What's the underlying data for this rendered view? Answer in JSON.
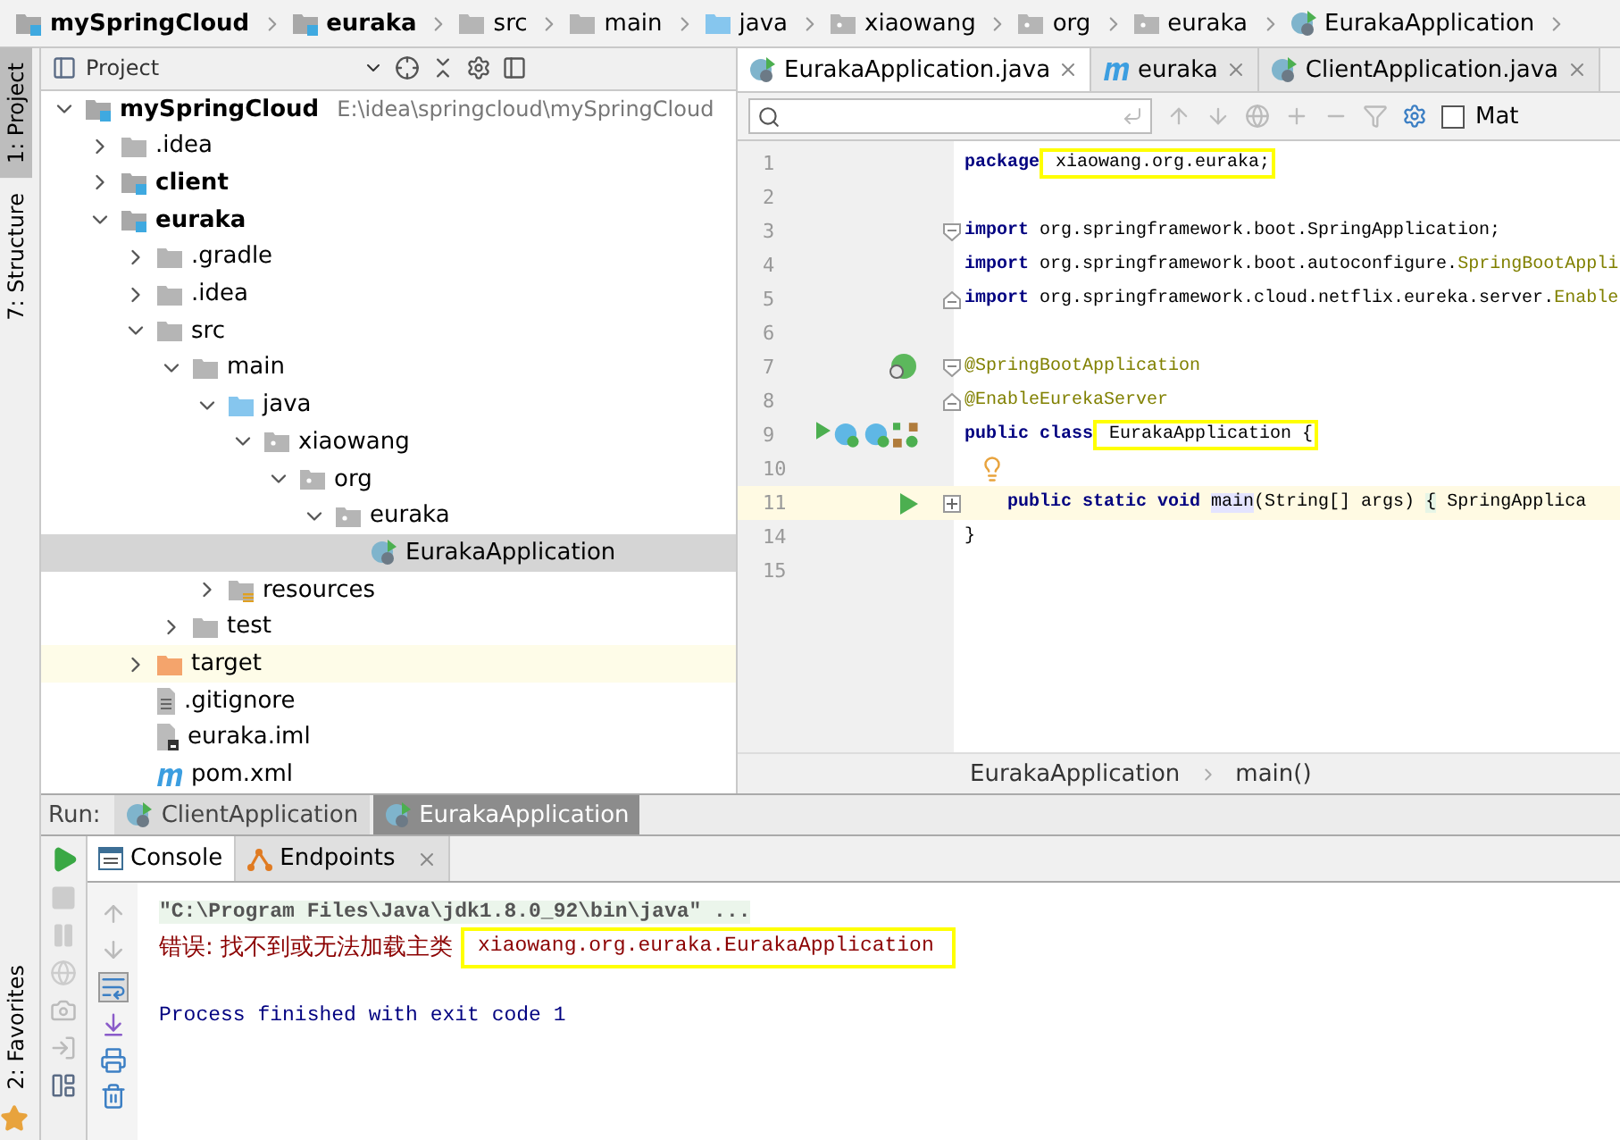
{
  "breadcrumbs": [
    {
      "label": "mySpringCloud",
      "kind": "module",
      "bold": true
    },
    {
      "label": "euraka",
      "kind": "module",
      "bold": true
    },
    {
      "label": "src",
      "kind": "folder",
      "bold": false
    },
    {
      "label": "main",
      "kind": "folder",
      "bold": false
    },
    {
      "label": "java",
      "kind": "source",
      "bold": false
    },
    {
      "label": "xiaowang",
      "kind": "package",
      "bold": false
    },
    {
      "label": "org",
      "kind": "package",
      "bold": false
    },
    {
      "label": "euraka",
      "kind": "package",
      "bold": false
    },
    {
      "label": "EurakaApplication",
      "kind": "spring-class",
      "bold": false
    }
  ],
  "tool_strip": {
    "top": [
      {
        "label": "1: Project",
        "selected": true
      },
      {
        "label": "7: Structure",
        "selected": false
      }
    ],
    "bottom": [
      {
        "label": "2: Favorites",
        "selected": false
      }
    ]
  },
  "project": {
    "title": "Project",
    "tree": [
      {
        "label": "mySpringCloud",
        "hint": "E:\\idea\\springcloud\\mySpringCloud",
        "kind": "module",
        "bold": true,
        "expanded": true,
        "selected": false,
        "highlighted": false,
        "children": [
          {
            "label": ".idea",
            "kind": "folder",
            "bold": false,
            "expanded": false,
            "selected": false,
            "highlighted": false
          },
          {
            "label": "client",
            "kind": "module",
            "bold": true,
            "expanded": false,
            "selected": false,
            "highlighted": false
          },
          {
            "label": "euraka",
            "kind": "module",
            "bold": true,
            "expanded": true,
            "selected": false,
            "highlighted": false,
            "children": [
              {
                "label": ".gradle",
                "kind": "folder",
                "bold": false,
                "expanded": false,
                "selected": false,
                "highlighted": false
              },
              {
                "label": ".idea",
                "kind": "folder",
                "bold": false,
                "expanded": false,
                "selected": false,
                "highlighted": false
              },
              {
                "label": "src",
                "kind": "folder",
                "bold": false,
                "expanded": true,
                "selected": false,
                "highlighted": false,
                "children": [
                  {
                    "label": "main",
                    "kind": "folder",
                    "bold": false,
                    "expanded": true,
                    "selected": false,
                    "highlighted": false,
                    "children": [
                      {
                        "label": "java",
                        "kind": "source",
                        "bold": false,
                        "expanded": true,
                        "selected": false,
                        "highlighted": false,
                        "children": [
                          {
                            "label": "xiaowang",
                            "kind": "package",
                            "bold": false,
                            "expanded": true,
                            "selected": false,
                            "highlighted": false,
                            "children": [
                              {
                                "label": "org",
                                "kind": "package",
                                "bold": false,
                                "expanded": true,
                                "selected": false,
                                "highlighted": false,
                                "children": [
                                  {
                                    "label": "euraka",
                                    "kind": "package",
                                    "bold": false,
                                    "expanded": true,
                                    "selected": false,
                                    "highlighted": false,
                                    "children": [
                                      {
                                        "label": "EurakaApplication",
                                        "kind": "spring-class",
                                        "bold": false,
                                        "selected": true,
                                        "highlighted": false
                                      }
                                    ]
                                  }
                                ]
                              }
                            ]
                          }
                        ]
                      },
                      {
                        "label": "resources",
                        "kind": "resources",
                        "bold": false,
                        "expanded": false,
                        "selected": false,
                        "highlighted": false
                      }
                    ]
                  },
                  {
                    "label": "test",
                    "kind": "folder",
                    "bold": false,
                    "expanded": false,
                    "selected": false,
                    "highlighted": false
                  }
                ]
              },
              {
                "label": "target",
                "kind": "excluded",
                "bold": false,
                "expanded": false,
                "selected": false,
                "highlighted": true
              },
              {
                "label": ".gitignore",
                "kind": "text",
                "bold": false,
                "selected": false,
                "highlighted": false
              },
              {
                "label": "euraka.iml",
                "kind": "iml",
                "bold": false,
                "selected": false,
                "highlighted": false
              },
              {
                "label": "pom.xml",
                "kind": "maven",
                "bold": false,
                "selected": false,
                "highlighted": false
              }
            ]
          }
        ]
      }
    ]
  },
  "editor": {
    "tabs": [
      {
        "label": "EurakaApplication.java",
        "kind": "spring-class",
        "selected": true
      },
      {
        "label": "euraka",
        "kind": "maven",
        "selected": false
      },
      {
        "label": "ClientApplication.java",
        "kind": "spring-class",
        "selected": false
      }
    ],
    "match_case": {
      "label": "Mat",
      "checked": false
    },
    "lines": [
      {
        "number": "1",
        "current": false,
        "tokens": [
          {
            "text": "package",
            "kind": "keyword"
          },
          {
            "text": " xiaowang.org.euraka;",
            "kind": "plain",
            "highlight": true
          }
        ]
      },
      {
        "number": "2",
        "current": false
      },
      {
        "number": "3",
        "current": false,
        "kind": "fold-start",
        "tokens": [
          {
            "text": "import",
            "kind": "keyword"
          },
          {
            "text": " org.springframework.boot.SpringApplication;",
            "kind": "plain"
          }
        ]
      },
      {
        "number": "4",
        "current": false,
        "tokens": [
          {
            "text": "import",
            "kind": "keyword"
          },
          {
            "text": " org.springframework.boot.autoconfigure.",
            "kind": "plain"
          },
          {
            "text": "SpringBootAppli",
            "kind": "annotation"
          }
        ]
      },
      {
        "number": "5",
        "current": false,
        "kind": "fold-end",
        "tokens": [
          {
            "text": "import",
            "kind": "keyword"
          },
          {
            "text": " org.springframework.cloud.netflix.eureka.server.",
            "kind": "plain"
          },
          {
            "text": "Enable",
            "kind": "annotation"
          }
        ]
      },
      {
        "number": "6",
        "current": false
      },
      {
        "number": "7",
        "current": false,
        "kind": "fold-start",
        "gutter": [
          {
            "kind": "spring-search"
          }
        ],
        "tokens": [
          {
            "text": "@SpringBootApplication",
            "kind": "annotation"
          }
        ]
      },
      {
        "number": "8",
        "current": false,
        "kind": "fold-end",
        "tokens": [
          {
            "text": "@EnableEurekaServer",
            "kind": "annotation"
          }
        ]
      },
      {
        "number": "9",
        "current": false,
        "gutter": [
          {
            "kind": "run"
          },
          {
            "kind": "class"
          },
          {
            "kind": "class"
          },
          {
            "kind": "beans"
          }
        ],
        "tokens": [
          {
            "text": "public class",
            "kind": "keyword"
          },
          {
            "text": " EurakaApplication {",
            "kind": "plain",
            "highlight": true
          }
        ]
      },
      {
        "number": "10",
        "current": false,
        "bulb": true
      },
      {
        "number": "11",
        "current": true,
        "kind": "fold-collapsed",
        "gutter": [
          {
            "kind": "run"
          }
        ],
        "tokens": [
          {
            "text": "    public static void ",
            "kind": "keyword"
          },
          {
            "text": "main",
            "kind": "usage"
          },
          {
            "text": "(String[] args) ",
            "kind": "plain"
          },
          {
            "text": "{",
            "kind": "brace"
          },
          {
            "text": " SpringApplica",
            "kind": "plain"
          }
        ]
      },
      {
        "number": "14",
        "current": false,
        "tokens": [
          {
            "text": "}",
            "kind": "plain"
          }
        ]
      },
      {
        "number": "15",
        "current": false
      }
    ],
    "path": [
      "EurakaApplication",
      "main()"
    ]
  },
  "run": {
    "label": "Run:",
    "tabs": [
      {
        "label": "ClientApplication",
        "selected": false
      },
      {
        "label": "EurakaApplication",
        "selected": true
      }
    ],
    "console_tabs": [
      {
        "label": "Console",
        "kind": "console",
        "selected": true,
        "closable": false
      },
      {
        "label": "Endpoints",
        "kind": "endpoints",
        "selected": false,
        "closable": true
      }
    ],
    "output": [
      {
        "kind": "command",
        "text": "\"C:\\Program Files\\Java\\jdk1.8.0_92\\bin\\java\" ..."
      },
      {
        "kind": "error",
        "text": "错误: 找不到或无法加载主类",
        "detail": "xiaowang.org.euraka.EurakaApplication"
      },
      {
        "kind": "blank"
      },
      {
        "kind": "info",
        "text": "Process finished with exit code 1"
      }
    ]
  }
}
